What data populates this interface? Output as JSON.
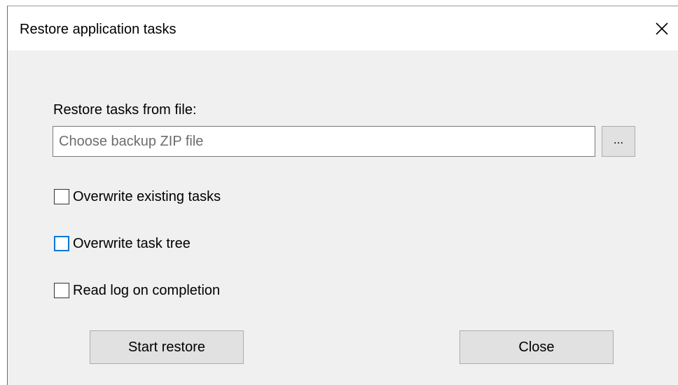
{
  "window": {
    "title": "Restore application tasks"
  },
  "icons": {
    "close": "close-icon"
  },
  "restore": {
    "section_label": "Restore tasks from file:",
    "file_input": {
      "value": "",
      "placeholder": "Choose backup ZIP file"
    },
    "browse_label": "..."
  },
  "options": [
    {
      "label": "Overwrite existing tasks",
      "checked": false
    },
    {
      "label": "Overwrite task tree",
      "checked": false,
      "focused": true
    },
    {
      "label": "Read log on completion",
      "checked": false
    }
  ],
  "buttons": {
    "start_label": "Start restore",
    "close_label": "Close"
  },
  "colors": {
    "focus_accent": "#0078d7",
    "dialog_background": "#f0f0f0",
    "button_background": "#e1e1e1"
  }
}
